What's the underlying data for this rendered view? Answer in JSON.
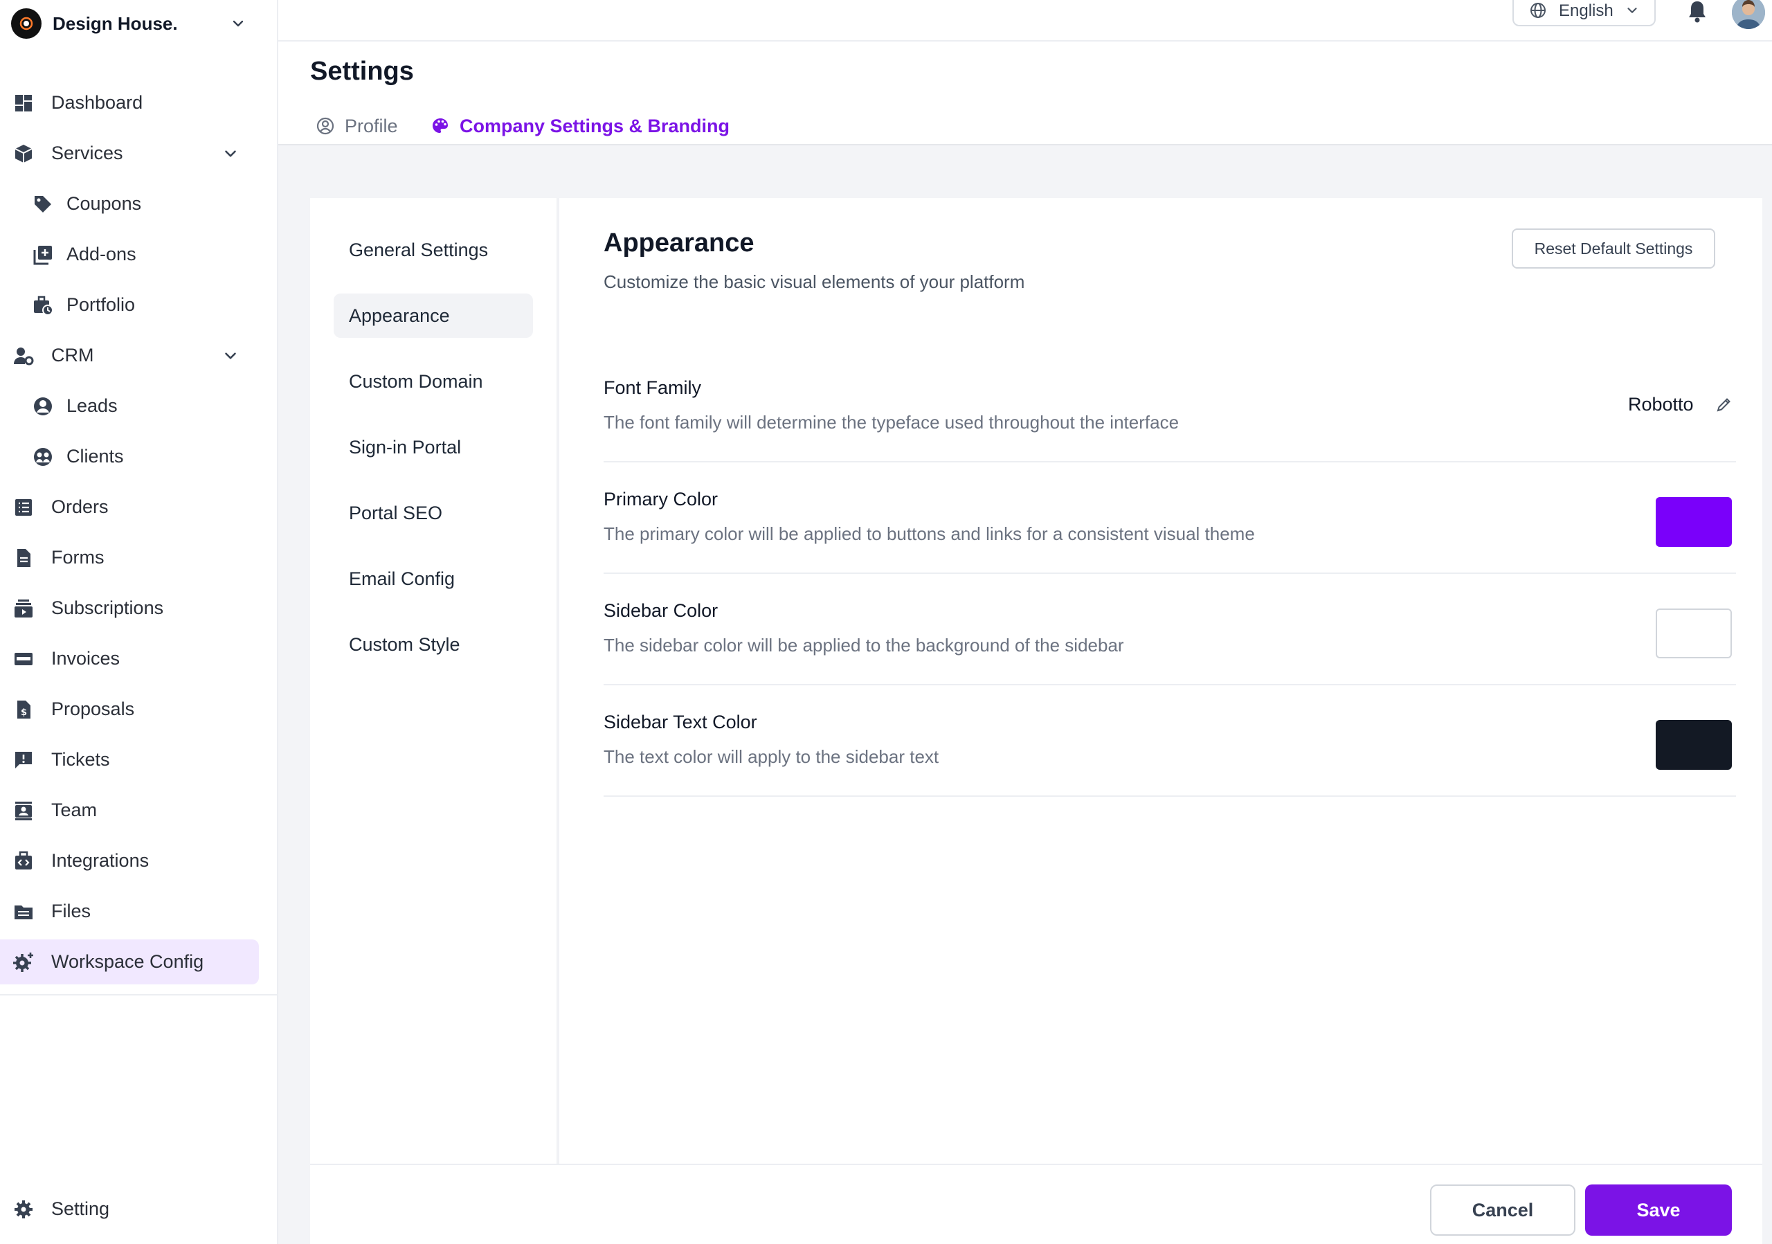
{
  "brand": {
    "name": "Design House."
  },
  "sidebar": {
    "items": [
      {
        "label": "Dashboard",
        "icon": "dashboard-icon"
      },
      {
        "label": "Services",
        "icon": "cube-icon",
        "expandable": true
      },
      {
        "label": "Coupons",
        "icon": "tag-icon",
        "sub": true
      },
      {
        "label": "Add-ons",
        "icon": "add-box-icon",
        "sub": true
      },
      {
        "label": "Portfolio",
        "icon": "briefcase-clock-icon",
        "sub": true
      },
      {
        "label": "CRM",
        "icon": "user-gear-icon",
        "expandable": true
      },
      {
        "label": "Leads",
        "icon": "user-circle-icon",
        "sub": true
      },
      {
        "label": "Clients",
        "icon": "group-circle-icon",
        "sub": true
      },
      {
        "label": "Orders",
        "icon": "list-icon"
      },
      {
        "label": "Forms",
        "icon": "document-icon"
      },
      {
        "label": "Subscriptions",
        "icon": "subscriptions-icon"
      },
      {
        "label": "Invoices",
        "icon": "card-icon"
      },
      {
        "label": "Proposals",
        "icon": "dollar-document-icon"
      },
      {
        "label": "Tickets",
        "icon": "alert-message-icon"
      },
      {
        "label": "Team",
        "icon": "contact-card-icon"
      },
      {
        "label": "Integrations",
        "icon": "code-briefcase-icon"
      },
      {
        "label": "Files",
        "icon": "folder-icon"
      },
      {
        "label": "Workspace Config",
        "icon": "gear-plus-icon",
        "active": true
      }
    ],
    "bottom": {
      "label": "Setting",
      "icon": "gear-icon"
    }
  },
  "topbar": {
    "language": "English"
  },
  "page": {
    "title": "Settings",
    "tabs": [
      {
        "label": "Profile",
        "icon": "user-circle-icon"
      },
      {
        "label": "Company Settings & Branding",
        "icon": "palette-icon",
        "active": true
      }
    ]
  },
  "subnav": {
    "items": [
      "General Settings",
      "Appearance",
      "Custom Domain",
      "Sign-in Portal",
      "Portal SEO",
      "Email Config",
      "Custom Style"
    ],
    "active": "Appearance"
  },
  "appearance": {
    "title": "Appearance",
    "subtitle": "Customize the basic visual elements of your platform",
    "reset_label": "Reset Default Settings",
    "settings": [
      {
        "title": "Font Family",
        "description": "The font family will determine the typeface used throughout the interface",
        "value": "Robotto"
      },
      {
        "title": "Primary Color",
        "description": "The primary color will be applied to buttons and links for a consistent visual theme",
        "color": "#7a00fa"
      },
      {
        "title": "Sidebar Color",
        "description": "The sidebar color will be applied to the background of the sidebar",
        "color": "#ffffff"
      },
      {
        "title": "Sidebar Text Color",
        "description": "The text color will apply to the sidebar text",
        "color": "#131924"
      }
    ]
  },
  "footer": {
    "cancel_label": "Cancel",
    "save_label": "Save"
  },
  "colors": {
    "accent": "#7b13e6",
    "active_bg": "#f1e8ff",
    "page_bg": "#f3f4f7"
  }
}
